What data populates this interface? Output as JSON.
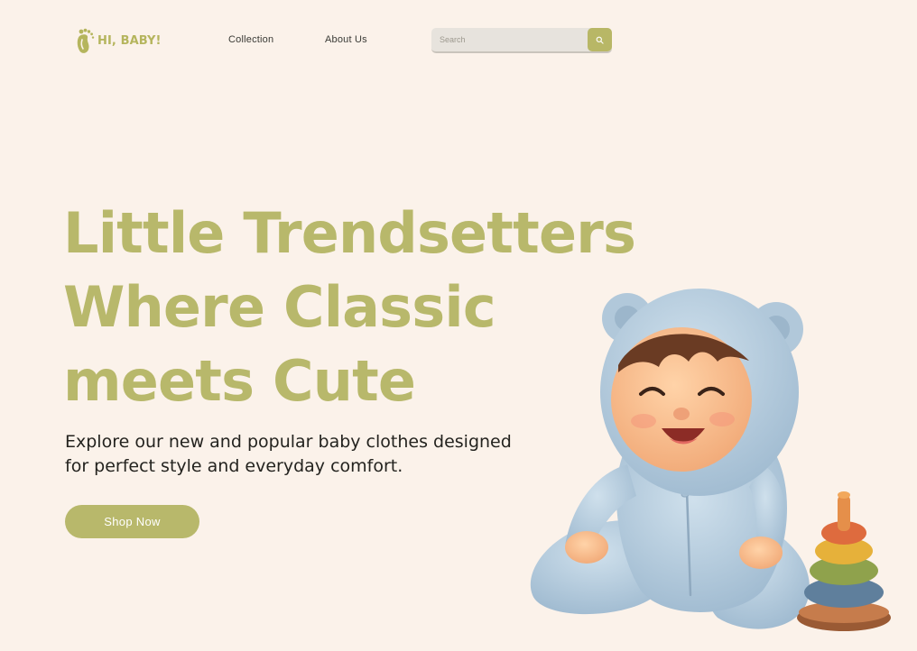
{
  "brand": {
    "name": "HI, BABY!",
    "color": "#b5b55d"
  },
  "nav": {
    "items": [
      {
        "label": "Collection"
      },
      {
        "label": "About Us"
      }
    ]
  },
  "search": {
    "placeholder": "Search",
    "icon": "search-icon"
  },
  "hero": {
    "title_lines": [
      "Little Trendsetters",
      "Where Classic",
      "meets Cute"
    ],
    "subtitle_lines": [
      "Explore our new and popular baby clothes designed",
      "for perfect style and everyday comfort."
    ],
    "cta_label": "Shop Now",
    "illustration": "baby-in-blue-bear-hoodie-with-stacking-ring-toy"
  },
  "colors": {
    "background": "#fbf2ea",
    "accent": "#b8b86b",
    "text": "#24231f"
  }
}
